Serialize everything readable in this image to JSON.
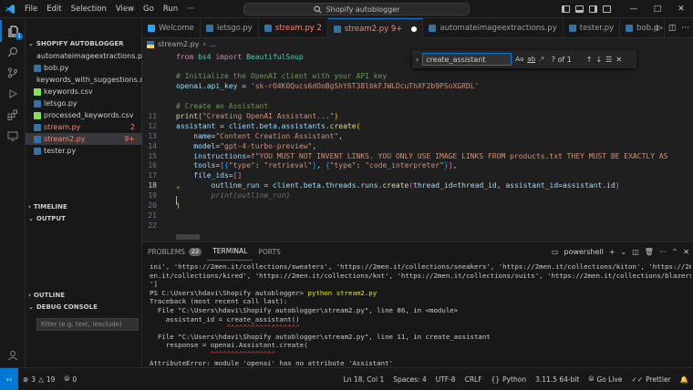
{
  "titlebar": {
    "menu": [
      "File",
      "Edit",
      "Selection",
      "View",
      "Go",
      "Run"
    ],
    "more": "···",
    "search_text": "Shopify autoblogger"
  },
  "activity": {
    "explorer_badge": "1"
  },
  "sidebar": {
    "title": "SHOPIFY AUTOBLOGGER",
    "files": [
      {
        "name": "automateimageextractions.py",
        "count": "",
        "state": "normal",
        "icon_color": "#3572a5"
      },
      {
        "name": "bob.py",
        "count": "",
        "state": "normal",
        "icon_color": "#3572a5"
      },
      {
        "name": "keywords_with_suggestions.csv",
        "count": "",
        "state": "normal",
        "icon_color": "#89e051"
      },
      {
        "name": "keywords.csv",
        "count": "",
        "state": "normal",
        "icon_color": "#89e051"
      },
      {
        "name": "letsgo.py",
        "count": "",
        "state": "normal",
        "icon_color": "#3572a5"
      },
      {
        "name": "processed_keywords.csv",
        "count": "",
        "state": "normal",
        "icon_color": "#89e051"
      },
      {
        "name": "stream.py",
        "count": "2",
        "state": "err",
        "icon_color": "#3572a5"
      },
      {
        "name": "stream2.py",
        "count": "9+",
        "state": "err-selected",
        "icon_color": "#3572a5"
      },
      {
        "name": "tester.py",
        "count": "",
        "state": "normal",
        "icon_color": "#3572a5"
      }
    ],
    "timeline": "TIMELINE",
    "output": "OUTPUT",
    "outline": "OUTLINE",
    "debug_console": "DEBUG CONSOLE",
    "filter_placeholder": "Filter (e.g. text, !exclude)"
  },
  "tabs": [
    {
      "label": "Welcome",
      "state": "normal",
      "dirty": false
    },
    {
      "label": "letsgo.py",
      "state": "normal",
      "dirty": false
    },
    {
      "label": "stream.py 2",
      "state": "err",
      "dirty": false
    },
    {
      "label": "stream2.py 9+",
      "state": "err-active",
      "dirty": true
    },
    {
      "label": "automateimageextractions.py",
      "state": "normal",
      "dirty": false
    },
    {
      "label": "tester.py",
      "state": "normal",
      "dirty": false
    },
    {
      "label": "bob.p",
      "state": "normal",
      "dirty": false
    }
  ],
  "breadcrumb": {
    "file": "stream2.py",
    "more": "..."
  },
  "find": {
    "query": "create_assistant",
    "opt_case": "Aa",
    "opt_word": "ab",
    "opt_regex": ".*",
    "result": "? of 1"
  },
  "editor": {
    "lines": [
      {
        "n": "",
        "html": ""
      },
      {
        "n": "",
        "html": ""
      },
      {
        "n": "",
        "html": ""
      },
      {
        "n": "",
        "html": ""
      },
      {
        "n": "",
        "html": ""
      },
      {
        "n": "",
        "html": ""
      },
      {
        "n": "",
        "html": ""
      },
      {
        "n": "",
        "html": ""
      },
      {
        "n": "",
        "html": ""
      },
      {
        "n": "11",
        "html": ""
      },
      {
        "n": "12",
        "html": ""
      },
      {
        "n": "13",
        "html": ""
      },
      {
        "n": "14",
        "html": ""
      },
      {
        "n": "15",
        "html": ""
      },
      {
        "n": "16",
        "html": ""
      },
      {
        "n": "17",
        "html": ""
      },
      {
        "n": "18",
        "html": ""
      },
      {
        "n": "19",
        "html": ""
      },
      {
        "n": "20",
        "html": ""
      },
      {
        "n": "21",
        "html": ""
      },
      {
        "n": "22",
        "html": ""
      }
    ],
    "code": [
      {
        "segs": [
          [
            "k-kw",
            "from "
          ],
          [
            "k-cls",
            "bs4"
          ],
          [
            "k-kw",
            " import "
          ],
          [
            "k-cls",
            "BeautifulSoup"
          ]
        ]
      },
      {
        "segs": []
      },
      {
        "segs": [
          [
            "k-com",
            "# Initialize the OpenAI client with your API key"
          ]
        ]
      },
      {
        "segs": [
          [
            "k-var",
            "openai"
          ],
          [
            "k-punc",
            "."
          ],
          [
            "k-var",
            "api_key"
          ],
          [
            "k-punc",
            " = "
          ],
          [
            "k-str",
            "'sk-rO4K0Qucs6dOoBgShY6T38lbkFJWLDcuThXF2b9PSoXGRDL'"
          ]
        ]
      },
      {
        "segs": []
      },
      {
        "segs": [
          [
            "k-com",
            "# Create an Assistant"
          ]
        ]
      },
      {
        "segs": [
          [
            "k-fn",
            "print"
          ],
          [
            "k-br",
            "("
          ],
          [
            "k-str",
            "\"Creating OpenAI Assistant...\""
          ],
          [
            "k-br",
            ")"
          ]
        ]
      },
      {
        "segs": [
          [
            "k-var",
            "assistant"
          ],
          [
            "k-punc",
            " = "
          ],
          [
            "k-var",
            "client"
          ],
          [
            "k-punc",
            "."
          ],
          [
            "k-var",
            "beta"
          ],
          [
            "k-punc",
            "."
          ],
          [
            "k-var",
            "assistants"
          ],
          [
            "k-punc",
            "."
          ],
          [
            "k-fn",
            "create"
          ],
          [
            "k-br",
            "("
          ]
        ]
      },
      {
        "segs": [
          [
            "k-punc",
            "    "
          ],
          [
            "k-var",
            "name"
          ],
          [
            "k-punc",
            "="
          ],
          [
            "k-str",
            "\"Content Creation Assistant\""
          ],
          [
            "k-punc",
            ","
          ]
        ]
      },
      {
        "segs": [
          [
            "k-punc",
            "    "
          ],
          [
            "k-var",
            "model"
          ],
          [
            "k-punc",
            "="
          ],
          [
            "k-str",
            "\"gpt-4-turbo-preview\""
          ],
          [
            "k-punc",
            ","
          ]
        ]
      },
      {
        "segs": [
          [
            "k-punc",
            "    "
          ],
          [
            "k-var",
            "instructions"
          ],
          [
            "k-punc",
            "="
          ],
          [
            "k-kw",
            "f"
          ],
          [
            "k-str",
            "\"YOU MUST NOT INVENT LINKS. YOU ONLY USE IMAGE LINKS FROM products.txt THEY MUST BE EXACTLY AS"
          ]
        ]
      },
      {
        "segs": [
          [
            "k-punc",
            "    "
          ],
          [
            "k-var",
            "tools"
          ],
          [
            "k-punc",
            "="
          ],
          [
            "k-br2",
            "["
          ],
          [
            "k-br3",
            "{"
          ],
          [
            "k-str",
            "\"type\""
          ],
          [
            "k-punc",
            ": "
          ],
          [
            "k-str",
            "\"retrieval\""
          ],
          [
            "k-br3",
            "}"
          ],
          [
            "k-punc",
            ", "
          ],
          [
            "k-br3",
            "{"
          ],
          [
            "k-str",
            "\"type\""
          ],
          [
            "k-punc",
            ": "
          ],
          [
            "k-str",
            "\"code_interpreter\""
          ],
          [
            "k-br3",
            "}"
          ],
          [
            "k-br2",
            "]"
          ],
          [
            "k-punc",
            ","
          ]
        ]
      },
      {
        "segs": [
          [
            "k-punc",
            "    "
          ],
          [
            "k-var",
            "file_ids"
          ],
          [
            "k-punc",
            "="
          ],
          [
            "k-br2",
            "[]"
          ]
        ]
      },
      {
        "segs": [
          [
            "k-punc",
            "        "
          ],
          [
            "k-var",
            "outline_run"
          ],
          [
            "k-punc",
            " = "
          ],
          [
            "k-var",
            "client"
          ],
          [
            "k-punc",
            "."
          ],
          [
            "k-var",
            "beta"
          ],
          [
            "k-punc",
            "."
          ],
          [
            "k-var",
            "threads"
          ],
          [
            "k-punc",
            "."
          ],
          [
            "k-var",
            "runs"
          ],
          [
            "k-punc",
            "."
          ],
          [
            "k-fn",
            "create"
          ],
          [
            "k-br2",
            "("
          ],
          [
            "k-var",
            "thread_id"
          ],
          [
            "k-punc",
            "="
          ],
          [
            "k-var",
            "thread_id"
          ],
          [
            "k-punc",
            ", "
          ],
          [
            "k-var",
            "assistant_id"
          ],
          [
            "k-punc",
            "="
          ],
          [
            "k-var",
            "assistant"
          ],
          [
            "k-punc",
            "."
          ],
          [
            "k-var",
            "id"
          ],
          [
            "k-br2",
            ")"
          ]
        ]
      },
      {
        "segs": [
          [
            "ghost",
            "        print(outline_run)"
          ]
        ]
      },
      {
        "segs": [
          [
            "k-br",
            ")"
          ]
        ]
      },
      {
        "segs": []
      },
      {
        "segs": []
      }
    ]
  },
  "panel": {
    "tabs": [
      {
        "label": "PROBLEMS",
        "badge": "22",
        "active": false
      },
      {
        "label": "TERMINAL",
        "badge": "",
        "active": true
      },
      {
        "label": "PORTS",
        "badge": "",
        "active": false
      }
    ],
    "shell": "powershell",
    "terminal": [
      {
        "cls": "",
        "text": "ini', 'https://2men.it/collections/sweaters', 'https://2men.it/collections/sneakers', 'https://2men.it/collections/kiton', 'https://2m"
      },
      {
        "cls": "",
        "text": "en.it/collections/kired', 'https://2men.it/collections/knt', 'https://2men.it/collections/suits', 'https://2men.it/collections/blazers"
      },
      {
        "cls": "",
        "text": "']"
      },
      {
        "cls": "prompt",
        "text": "PS C:\\Users\\hdavi\\Shopify autoblogger> ",
        "cmd": "python stream2.py"
      },
      {
        "cls": "",
        "text": "Traceback (most recent call last):"
      },
      {
        "cls": "",
        "text": "  File \"C:\\Users\\hdavi\\Shopify autoblogger\\stream2.py\", line 86, in <module>"
      },
      {
        "cls": "",
        "text": "    assistant_id = create_assistant()"
      },
      {
        "cls": "under",
        "text": "                   ^^^^^^^^^^^^^^^^^^"
      },
      {
        "cls": "",
        "text": "  File \"C:\\Users\\hdavi\\Shopify autoblogger\\stream2.py\", line 11, in create_assistant"
      },
      {
        "cls": "",
        "text": "    response = openai.Assistant.create("
      },
      {
        "cls": "under",
        "text": "               ^^^^^^^^^^^^^^^^"
      },
      {
        "cls": "",
        "text": "AttributeError: module 'openai' has no attribute 'Assistant'"
      },
      {
        "cls": "prompt-end",
        "text": "PS C:\\Users\\hdavi\\Shopify autoblogger> "
      }
    ]
  },
  "statusbar": {
    "errors": "3",
    "warnings": "19",
    "info": "0",
    "position": "Ln 18, Col 1",
    "spaces": "Spaces: 4",
    "encoding": "UTF-8",
    "eol": "CRLF",
    "language": "Python",
    "interpreter": "3.11.5 64-bit",
    "golive": "Go Live",
    "prettier": "Prettier"
  },
  "colors": {
    "accent": "#0078d4",
    "error": "#f48771"
  }
}
